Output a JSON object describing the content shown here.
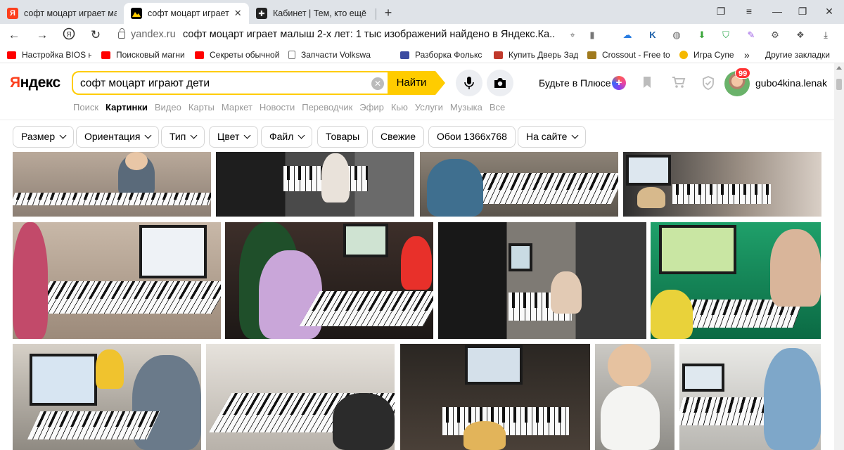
{
  "browser": {
    "tabs": [
      {
        "title": "софт моцарт играет малыш",
        "active": false,
        "favicon": "yandex-icon"
      },
      {
        "title": "софт моцарт играет малыш",
        "active": true,
        "favicon": "yandex-images-icon"
      },
      {
        "title": "Кабинет | Тем, кто ещё бо",
        "active": false,
        "favicon": "cabinet-icon"
      }
    ],
    "new_tab": "+",
    "domain": "yandex.ru",
    "page_title": "софт моцарт играет малыш 2-х лет: 1 тыс изображений найдено в Яндекс.Ка...",
    "bookmarks": [
      {
        "label": "Настройка BIOS н",
        "icon": "youtube-icon",
        "color": "#ff0000"
      },
      {
        "label": "Поисковый магни",
        "icon": "youtube-icon",
        "color": "#ff0000"
      },
      {
        "label": "Секреты обычной",
        "icon": "youtube-icon",
        "color": "#ff0000"
      },
      {
        "label": "Запчасти Volkswa",
        "icon": "page-icon",
        "color": "#777777"
      },
      {
        "label": "Разборка Фолькс",
        "icon": "site-icon",
        "color": "#3b4aa0"
      },
      {
        "label": "Купить Дверь Зад",
        "icon": "site-icon",
        "color": "#c0392b"
      },
      {
        "label": "Crossout - Free to",
        "icon": "game-icon",
        "color": "#a07a1e"
      },
      {
        "label": "Игра Супе",
        "icon": "game-icon",
        "color": "#f5b800"
      }
    ],
    "bookmarks_more": "»",
    "other_bookmarks": "Другие закладки"
  },
  "header": {
    "logo_ya": "Я",
    "logo_rest": "ндекс",
    "query": "софт моцарт играют дети",
    "find_label": "Найти",
    "plus_label": "Будьте в Плюсе",
    "badge_count": "99",
    "username": "gubo4kina.lenak"
  },
  "services": [
    "Поиск",
    "Картинки",
    "Видео",
    "Карты",
    "Маркет",
    "Новости",
    "Переводчик",
    "Эфир",
    "Кью",
    "Услуги",
    "Музыка",
    "Все"
  ],
  "active_service": "Картинки",
  "filters": [
    {
      "label": "Размер",
      "dropdown": true
    },
    {
      "label": "Ориентация",
      "dropdown": true
    },
    {
      "label": "Тип",
      "dropdown": true
    },
    {
      "label": "Цвет",
      "dropdown": true
    },
    {
      "label": "Файл",
      "dropdown": true
    },
    {
      "label": "Товары",
      "dropdown": false
    },
    {
      "label": "Свежие",
      "dropdown": false
    },
    {
      "label": "Обои 1366x768",
      "dropdown": false
    },
    {
      "label": "На сайте",
      "dropdown": true
    }
  ],
  "colors": {
    "accent": "#ffcc00",
    "logo_red": "#fc3f1d",
    "muted_text": "#999999"
  }
}
